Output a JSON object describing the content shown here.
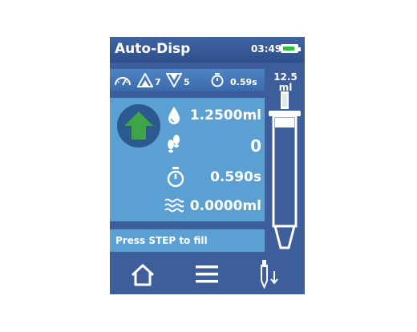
{
  "app": {
    "title": "Auto-Disp",
    "time": "03:49",
    "battery_level": 0.85
  },
  "status": {
    "aspirate_speed": "7",
    "dispense_speed": "5",
    "delay": "0.59s"
  },
  "tip": {
    "capacity": "12.5\nml"
  },
  "readings": {
    "volume": "1.2500ml",
    "steps": "0",
    "interval": "0.590s",
    "mix_volume": "0.0000ml"
  },
  "message": "Press STEP to fill",
  "icons": {
    "speed": "speedometer-icon",
    "aspirate": "aspirate-speed-icon",
    "dispense": "dispense-speed-icon",
    "timer": "stopwatch-icon",
    "direction": "up-arrow-icon",
    "drop": "drop-icon",
    "steps": "footsteps-icon",
    "waves": "waves-icon",
    "home": "home-icon",
    "menu": "menu-icon",
    "pipette": "pipette-eject-icon"
  },
  "colors": {
    "accent_green": "#3fa447",
    "panel": "#5aa0d3",
    "battery": "#2ac23a"
  }
}
